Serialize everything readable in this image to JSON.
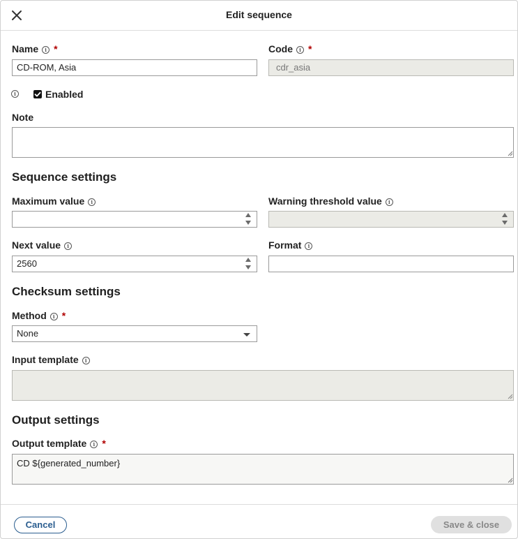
{
  "dialog": {
    "title": "Edit sequence"
  },
  "fields": {
    "name": {
      "label": "Name",
      "value": "CD-ROM, Asia",
      "required": "*"
    },
    "code": {
      "label": "Code",
      "value": "cdr_asia",
      "required": "*"
    },
    "enabled": {
      "label": "Enabled",
      "checked": true
    },
    "note": {
      "label": "Note",
      "value": ""
    }
  },
  "sequence_settings": {
    "heading": "Sequence settings",
    "maximum_value": {
      "label": "Maximum value",
      "value": ""
    },
    "warning_threshold": {
      "label": "Warning threshold value",
      "value": ""
    },
    "next_value": {
      "label": "Next value",
      "value": "2560"
    },
    "format": {
      "label": "Format",
      "value": ""
    }
  },
  "checksum_settings": {
    "heading": "Checksum settings",
    "method": {
      "label": "Method",
      "value": "None",
      "required": "*"
    },
    "input_template": {
      "label": "Input template",
      "value": ""
    }
  },
  "output_settings": {
    "heading": "Output settings",
    "output_template": {
      "label": "Output template",
      "value": "CD ${generated_number}",
      "required": "*"
    }
  },
  "footer": {
    "cancel_label": "Cancel",
    "save_label": "Save & close"
  },
  "colors": {
    "accent": "#2a5d8f",
    "required": "#b00000",
    "disabled_bg": "#ebebe6"
  }
}
